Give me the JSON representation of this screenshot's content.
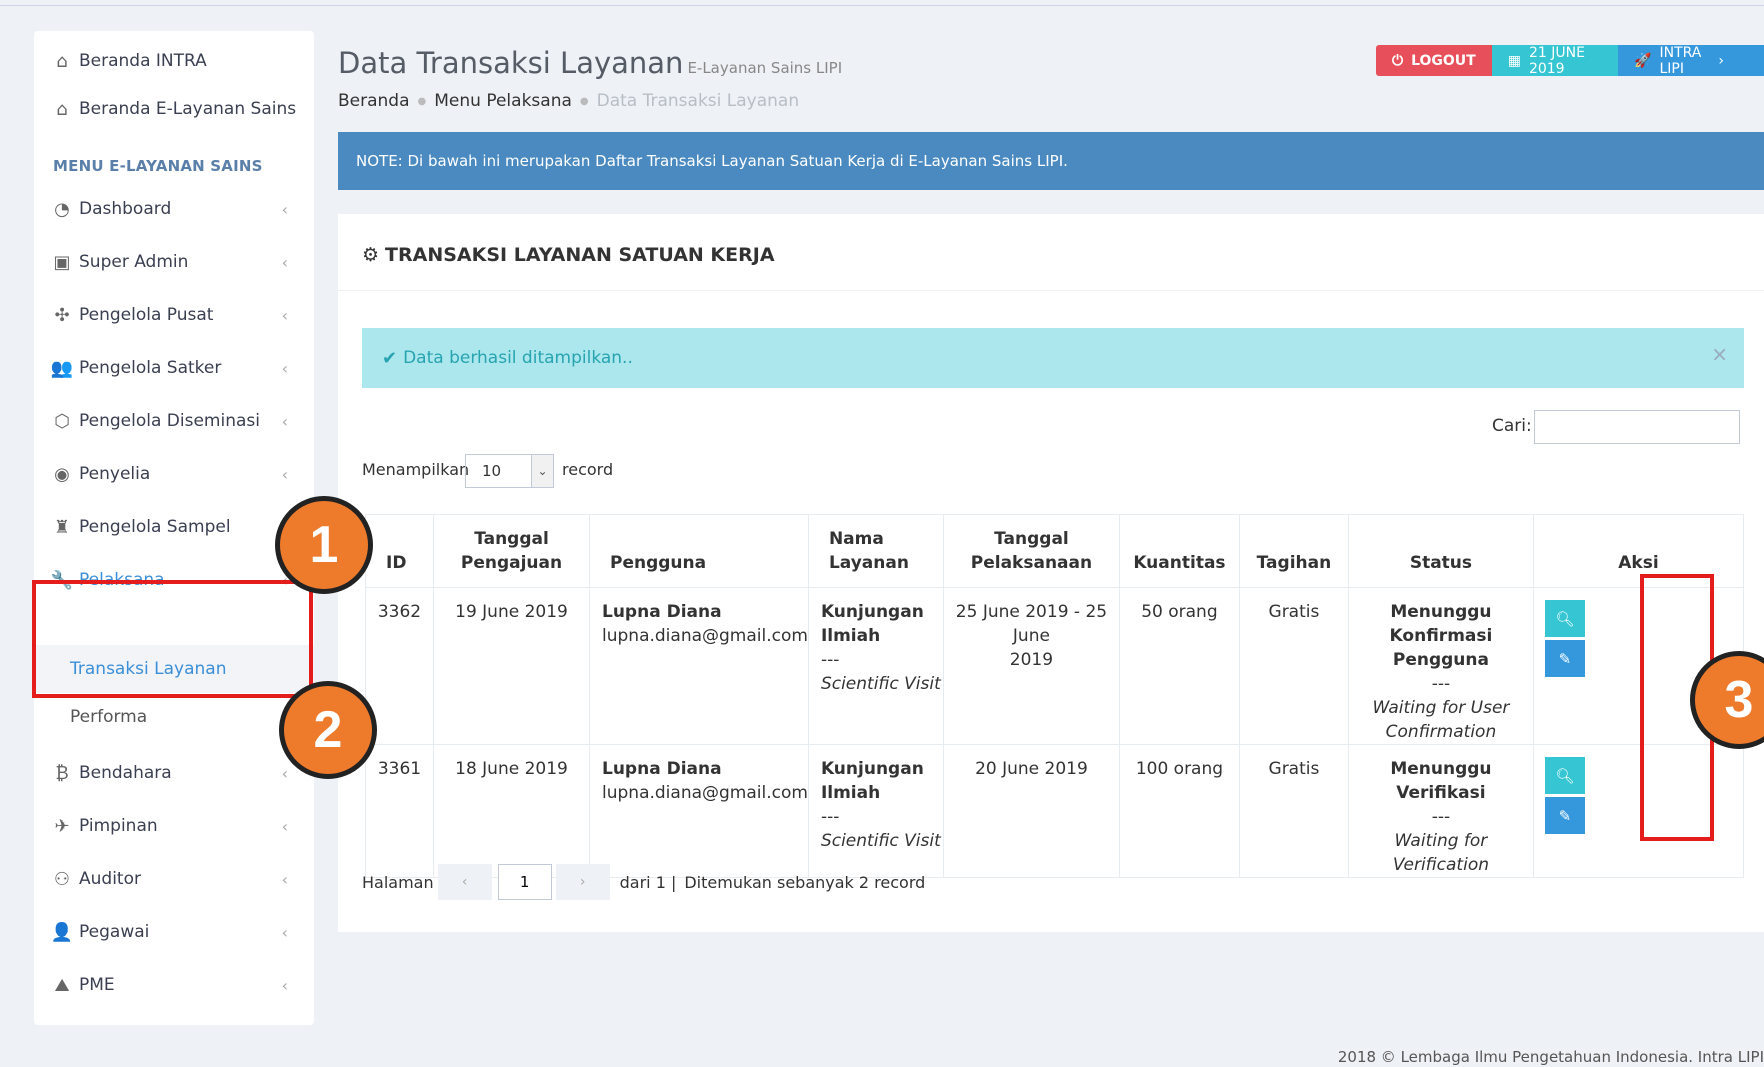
{
  "sidebar": {
    "top_links": [
      {
        "label": "Beranda INTRA",
        "icon": "home-icon"
      },
      {
        "label": "Beranda E-Layanan Sains",
        "icon": "home-icon"
      }
    ],
    "section_heading": "MENU E-LAYANAN SAINS",
    "items": [
      {
        "label": "Dashboard",
        "icon": "dashboard-icon"
      },
      {
        "label": "Super Admin",
        "icon": "train-icon"
      },
      {
        "label": "Pengelola Pusat",
        "icon": "move-icon"
      },
      {
        "label": "Pengelola Satker",
        "icon": "users-icon"
      },
      {
        "label": "Pengelola Diseminasi",
        "icon": "shield-icon"
      },
      {
        "label": "Penyelia",
        "icon": "eye-icon"
      },
      {
        "label": "Pengelola Sampel",
        "icon": "sitemap-icon"
      },
      {
        "label": "Pelaksana",
        "icon": "wrench-icon"
      },
      {
        "label": "Bendahara",
        "icon": "bitcoin-icon"
      },
      {
        "label": "Pimpinan",
        "icon": "plane-icon"
      },
      {
        "label": "Auditor",
        "icon": "binoculars-icon"
      },
      {
        "label": "Pegawai",
        "icon": "user-icon"
      },
      {
        "label": "PME",
        "icon": "road-icon"
      }
    ],
    "sub_items": [
      {
        "label": "Transaksi Layanan"
      },
      {
        "label": "Performa"
      }
    ]
  },
  "header": {
    "title": "Data Transaksi Layanan",
    "subtitle": "E-Layanan Sains LIPI",
    "breadcrumb": [
      "Beranda",
      "Menu Pelaksana",
      "Data Transaksi Layanan"
    ],
    "logout_label": "LOGOUT",
    "date_label": "21 JUNE 2019",
    "intra_label": "INTRA LIPI"
  },
  "note": "NOTE: Di bawah ini merupakan Daftar Transaksi Layanan Satuan Kerja di E-Layanan Sains LIPI.",
  "portlet": {
    "title": "TRANSAKSI LAYANAN SATUAN KERJA",
    "alert": "Data berhasil ditampilkan..",
    "search_label": "Cari:",
    "search_value": "",
    "length_prefix": "Menampilkan",
    "length_value": "10",
    "length_suffix": "record"
  },
  "table": {
    "headers": {
      "id": "ID",
      "tanggal_pengajuan": [
        "Tanggal",
        "Pengajuan"
      ],
      "pengguna": "Pengguna",
      "nama_layanan": [
        "Nama",
        "Layanan"
      ],
      "tanggal_pelaksanaan": [
        "Tanggal",
        "Pelaksanaan"
      ],
      "kuantitas": "Kuantitas",
      "tagihan": "Tagihan",
      "status": "Status",
      "aksi": "Aksi"
    },
    "rows": [
      {
        "id": "3362",
        "tanggal_pengajuan": "19 June 2019",
        "pengguna_nama": "Lupna Diana",
        "pengguna_email": "lupna.diana@gmail.com",
        "layanan": [
          "Kunjungan",
          "Ilmiah"
        ],
        "layanan_sep": "---",
        "layanan_en": "Scientific Visit",
        "tanggal_pelaksanaan": [
          "25 June 2019 - 25 June",
          "2019"
        ],
        "kuantitas": "50 orang",
        "tagihan": "Gratis",
        "status": [
          "Menunggu Konfirmasi",
          "Pengguna"
        ],
        "status_sep": "---",
        "status_en": [
          "Waiting for User",
          "Confirmation"
        ]
      },
      {
        "id": "3361",
        "tanggal_pengajuan": "18 June 2019",
        "pengguna_nama": "Lupna Diana",
        "pengguna_email": "lupna.diana@gmail.com",
        "layanan": [
          "Kunjungan",
          "Ilmiah"
        ],
        "layanan_sep": "---",
        "layanan_en": "Scientific Visit",
        "tanggal_pelaksanaan": [
          "20 June 2019"
        ],
        "kuantitas": "100 orang",
        "tagihan": "Gratis",
        "status": [
          "Menunggu Verifikasi"
        ],
        "status_sep": "---",
        "status_en": [
          "Waiting for Verification"
        ]
      }
    ]
  },
  "pagination": {
    "prefix": "Halaman",
    "page": "1",
    "suffix": "dari 1 |",
    "found": "Ditemukan sebanyak 2 record"
  },
  "footer": "2018 © Lembaga Ilmu Pengetahuan Indonesia. Intra LIPI",
  "annotations": [
    "1",
    "2",
    "3"
  ],
  "colors": {
    "logout": "#e7505a",
    "date": "#36c6d3",
    "intra": "#3598dc",
    "note_bg": "#4a8ac0",
    "alert_bg": "#abe7ed",
    "annotation_box": "#e51c1c",
    "annotation_circle": "#ee7a2c"
  }
}
